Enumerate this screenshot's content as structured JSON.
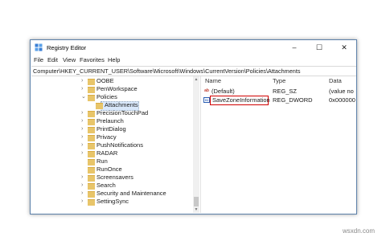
{
  "window": {
    "title": "Registry Editor",
    "minimize": "–",
    "maximize": "☐",
    "close": "✕"
  },
  "menu": [
    "File",
    "Edit",
    "View",
    "Favorites",
    "Help"
  ],
  "address": "Computer\\HKEY_CURRENT_USER\\Software\\Microsoft\\Windows\\CurrentVersion\\Policies\\Attachments",
  "tree": [
    {
      "label": "OOBE",
      "chev": "›"
    },
    {
      "label": "PenWorkspace",
      "chev": "›"
    },
    {
      "label": "Policies",
      "chev": "⌄"
    },
    {
      "label": "Attachments",
      "chev": "",
      "selected": true
    },
    {
      "label": "PrecisionTouchPad",
      "chev": "›"
    },
    {
      "label": "Prelaunch",
      "chev": "›"
    },
    {
      "label": "PrintDialog",
      "chev": "›"
    },
    {
      "label": "Privacy",
      "chev": "›"
    },
    {
      "label": "PushNotifications",
      "chev": "›"
    },
    {
      "label": "RADAR",
      "chev": "›"
    },
    {
      "label": "Run",
      "chev": ""
    },
    {
      "label": "RunOnce",
      "chev": ""
    },
    {
      "label": "Screensavers",
      "chev": "›"
    },
    {
      "label": "Search",
      "chev": "›"
    },
    {
      "label": "Security and Maintenance",
      "chev": "›"
    },
    {
      "label": "SettingSync",
      "chev": "›"
    }
  ],
  "list": {
    "columns": [
      "Name",
      "Type",
      "Data"
    ],
    "rows": [
      {
        "icon": "ab",
        "name": "(Default)",
        "type": "REG_SZ",
        "data": "(value no"
      },
      {
        "icon": "01",
        "name": "SaveZoneInformation",
        "type": "REG_DWORD",
        "data": "0x000000"
      }
    ]
  },
  "watermark": "wsxdn.com",
  "colors": {
    "highlight": "#d00000",
    "folder": "#e8c56a",
    "selection": "#d9e8fb"
  }
}
